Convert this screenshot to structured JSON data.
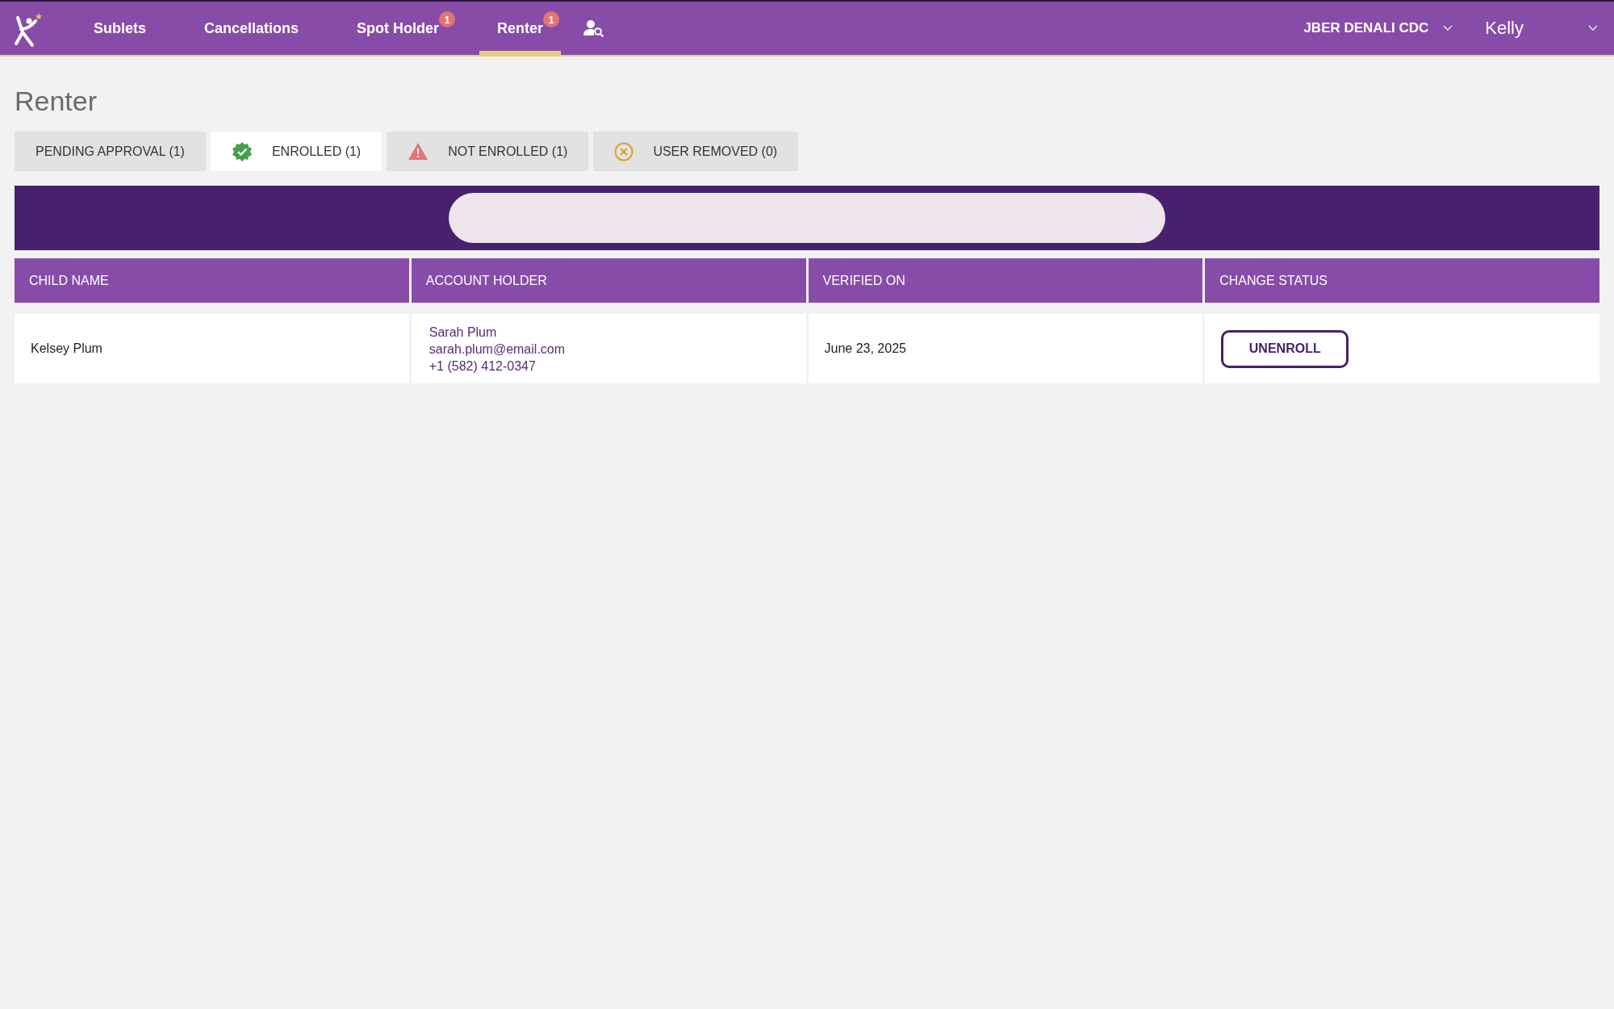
{
  "nav": {
    "items": [
      {
        "label": "Sublets",
        "selected": false
      },
      {
        "label": "Cancellations",
        "selected": false
      },
      {
        "label": "Spot Holder",
        "selected": false,
        "badge": "1"
      },
      {
        "label": "Renter",
        "selected": true,
        "badge": "1"
      }
    ],
    "location": "JBER DENALI CDC",
    "user": "Kelly"
  },
  "page_title": "Renter",
  "tabs": [
    {
      "label": "PENDING APPROVAL (1)",
      "selected": false,
      "kind": "plain"
    },
    {
      "label": "ENROLLED (1)",
      "selected": true,
      "kind": "enrolled"
    },
    {
      "label": "NOT ENROLLED (1)",
      "selected": false,
      "kind": "warning"
    },
    {
      "label": "USER REMOVED (0)",
      "selected": false,
      "kind": "removed"
    }
  ],
  "table": {
    "columns": [
      "CHILD NAME",
      "ACCOUNT HOLDER",
      "VERIFIED ON",
      "CHANGE STATUS"
    ],
    "rows": [
      {
        "child_name": "Kelsey Plum",
        "account_holder": [
          "Sarah Plum",
          "sarah.plum@email.com",
          "+1 (582) 412-0347"
        ],
        "verified_on": "June 23, 2025",
        "action": "UNENROLL"
      }
    ]
  }
}
